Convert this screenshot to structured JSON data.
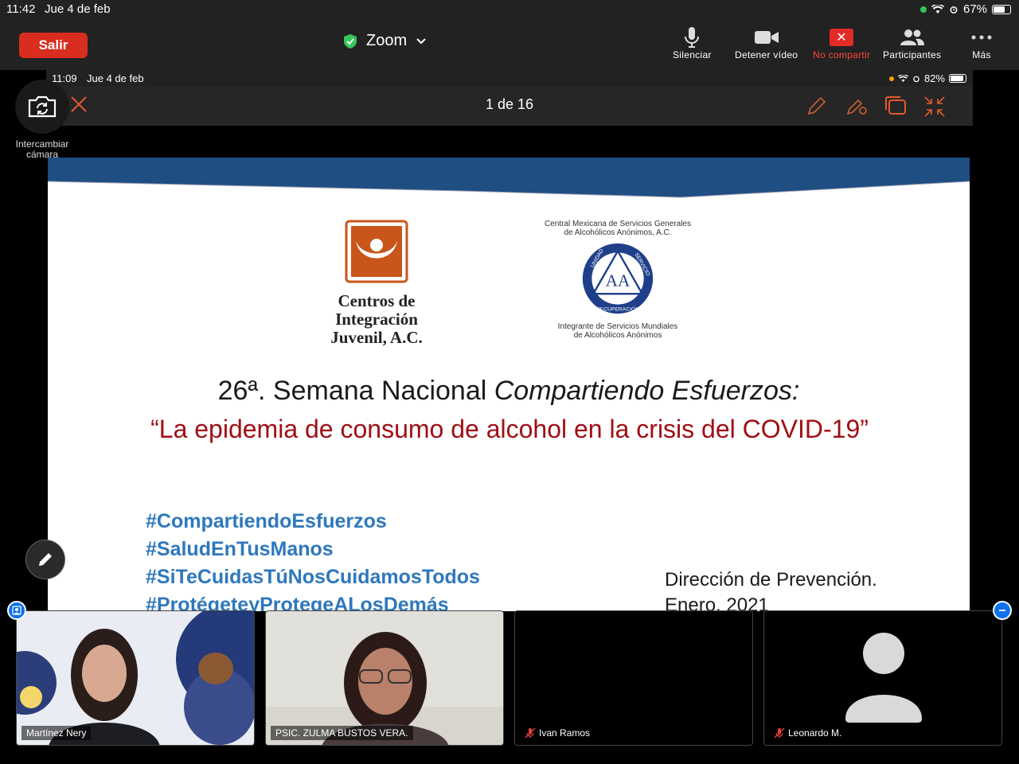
{
  "status_bar": {
    "time": "11:42",
    "date": "Jue 4 de feb",
    "battery": "67%",
    "battery_level": 0.67
  },
  "toolbar": {
    "leave_label": "Salir",
    "meeting_title": "Zoom",
    "items": [
      {
        "label": "Silenciar",
        "icon": "microphone-icon"
      },
      {
        "label": "Detener vídeo",
        "icon": "video-camera-icon"
      },
      {
        "label": "No compartir",
        "icon": "stop-share-icon"
      },
      {
        "label": "Participantes",
        "icon": "participants-icon"
      },
      {
        "label": "Más",
        "icon": "more-icon"
      }
    ]
  },
  "shared_screen": {
    "status_time": "11:09",
    "status_date": "Jue 4 de feb",
    "status_battery": "82%",
    "battery_level": 0.82,
    "page_indicator": "1 de 16"
  },
  "camera_swap_label": "Intercambiar cámara",
  "slide": {
    "logo_cij_text": [
      "Centros de",
      "Integración",
      "Juvenil, A.C."
    ],
    "logo_aa_top": [
      "Central Mexicana de Servicios Generales",
      "de Alcohólicos Anónimos, A.C."
    ],
    "logo_aa_bottom": [
      "Integrante de Servicios Mundiales",
      "de Alcohólicos Anónimos"
    ],
    "logo_aa_ring": [
      "UNIDAD",
      "SERVICIO",
      "RECUPERACIÓN"
    ],
    "title_plain": "26ª. Semana Nacional ",
    "title_italic": "Compartiendo Esfuerzos:",
    "subtitle": "“La epidemia de consumo de alcohol en la crisis del COVID-19”",
    "hashtags": [
      "#CompartiendoEsfuerzos",
      "#SaludEnTusManos",
      "#SiTeCuidasTúNosCuidamosTodos",
      "#ProtégeteyProtegeALosDemás"
    ],
    "direction": [
      "Dirección de Prevención.",
      "Enero, 2021"
    ],
    "colors": {
      "band": "#1f4e82",
      "subtitle": "#a00f14",
      "hashtags": "#2e78bd",
      "cij_orange": "#c8561a"
    }
  },
  "participants": [
    {
      "name": "Martínez Nery",
      "muted": false,
      "video": true
    },
    {
      "name": "PSIC. ZULMA BUSTOS VERA.",
      "muted": false,
      "video": true
    },
    {
      "name": "Ivan  Ramos",
      "muted": true,
      "video": false
    },
    {
      "name": "Leonardo M.",
      "muted": true,
      "video": false
    }
  ]
}
